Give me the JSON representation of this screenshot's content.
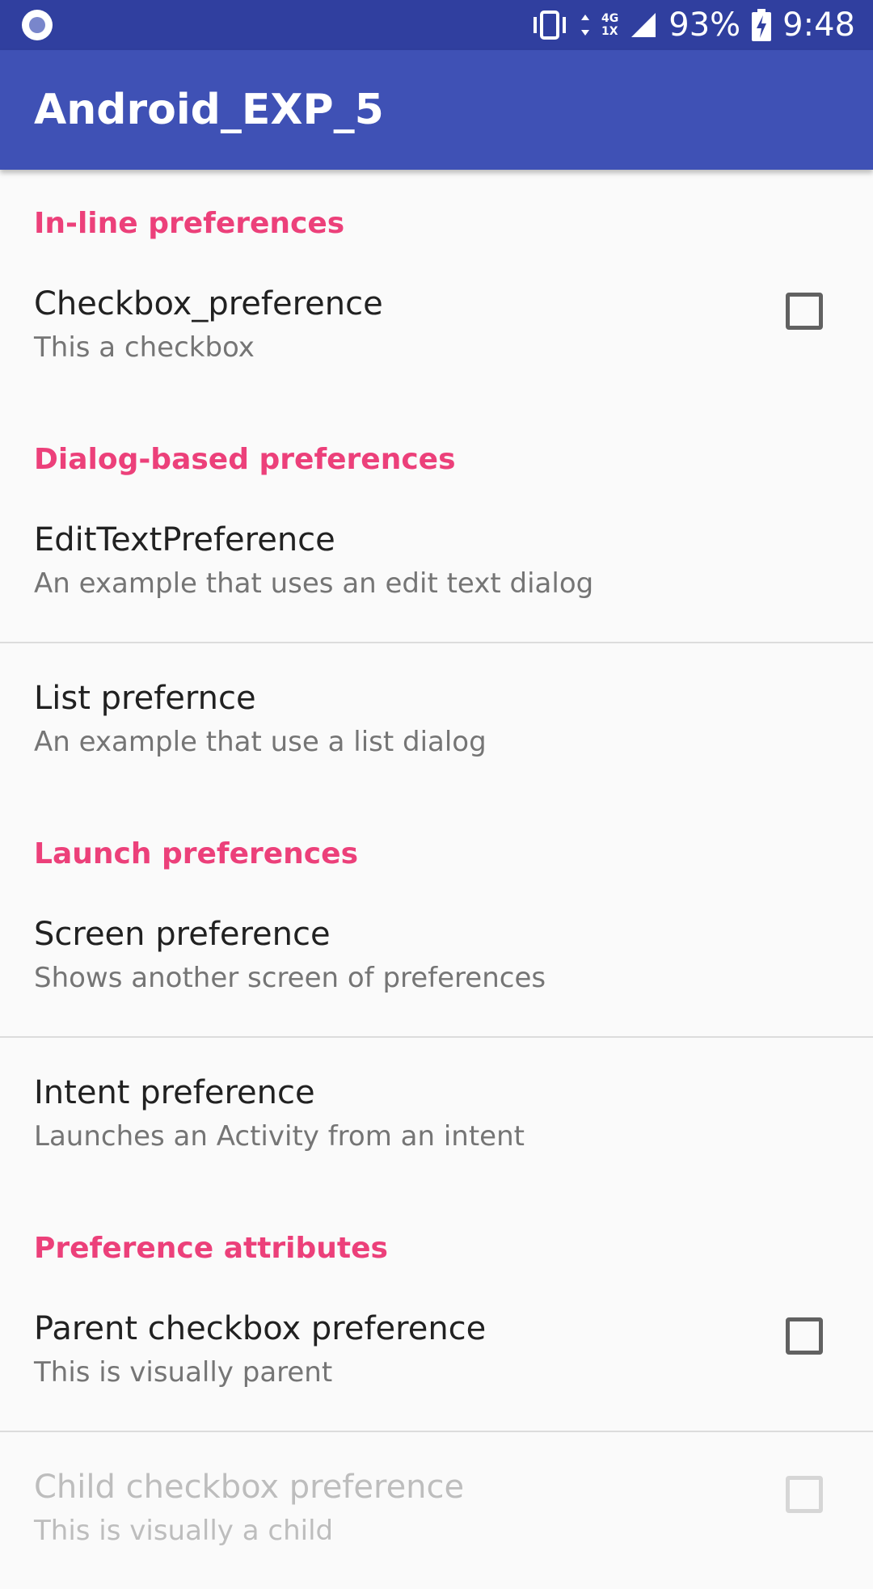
{
  "status_bar": {
    "network": [
      "4G",
      "1X"
    ],
    "battery": "93%",
    "time": "9:48"
  },
  "app_bar": {
    "title": "Android_EXP_5"
  },
  "categories": {
    "inline": "In-line preferences",
    "dialog": "Dialog-based preferences",
    "launch": "Launch preferences",
    "attributes": "Preference attributes"
  },
  "prefs": {
    "checkbox": {
      "title": "Checkbox_preference",
      "summary": "This a checkbox",
      "checked": false
    },
    "edit_text": {
      "title": "EditTextPreference",
      "summary": "An example that uses an edit text dialog"
    },
    "list": {
      "title": "List prefernce",
      "summary": "An example that use a list dialog"
    },
    "screen": {
      "title": "Screen preference",
      "summary": "Shows another screen of preferences"
    },
    "intent": {
      "title": "Intent preference",
      "summary": "Launches an Activity from an intent"
    },
    "parent": {
      "title": "Parent checkbox preference",
      "summary": "This is visually parent",
      "checked": false
    },
    "child": {
      "title": "Child checkbox preference",
      "summary": "This is visually a child",
      "checked": false,
      "enabled": false
    }
  },
  "colors": {
    "status_bar": "#303f9f",
    "app_bar": "#3f51b5",
    "category_accent": "#ec407a"
  }
}
